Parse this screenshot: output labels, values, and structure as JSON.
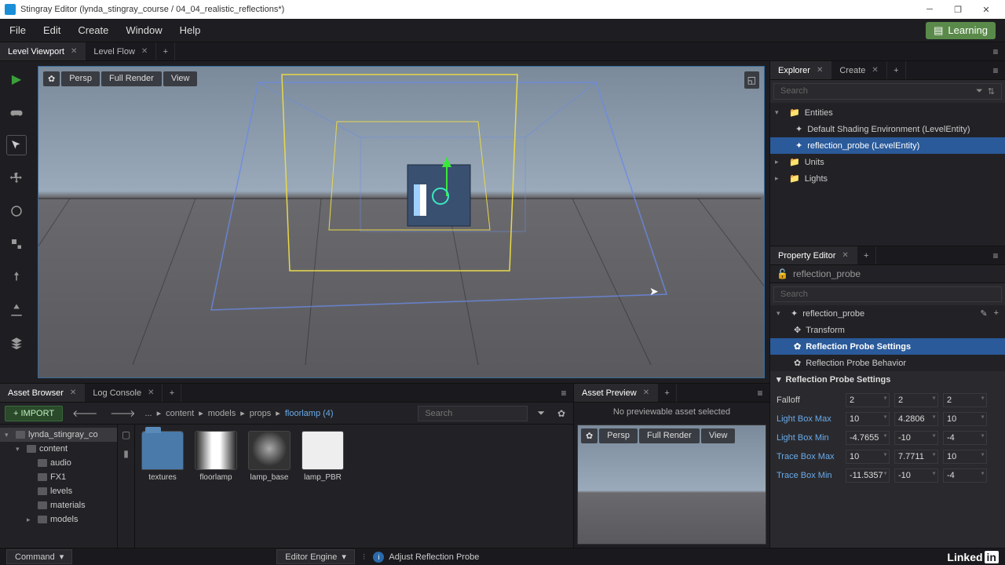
{
  "window": {
    "title": "Stingray Editor (lynda_stingray_course / 04_04_realistic_reflections*)"
  },
  "menubar": {
    "items": [
      "File",
      "Edit",
      "Create",
      "Window",
      "Help"
    ],
    "learning": "Learning"
  },
  "main_tabs": {
    "viewport": "Level Viewport",
    "flow": "Level Flow"
  },
  "viewport": {
    "persp": "Persp",
    "render": "Full Render",
    "view": "View"
  },
  "bottom_tabs": {
    "asset_browser": "Asset Browser",
    "log_console": "Log Console",
    "asset_preview": "Asset Preview"
  },
  "asset_browser": {
    "import": "+ IMPORT",
    "breadcrumb": [
      "...",
      "content",
      "models",
      "props",
      "floorlamp (4)"
    ],
    "search_placeholder": "Search",
    "tree": {
      "root": "lynda_stingray_co",
      "items": [
        "content",
        "audio",
        "FX1",
        "levels",
        "materials",
        "models"
      ]
    },
    "thumbs": [
      {
        "label": "textures",
        "type": "folder"
      },
      {
        "label": "floorlamp",
        "type": "tex"
      },
      {
        "label": "lamp_base",
        "type": "tex"
      },
      {
        "label": "lamp_PBR",
        "type": "tex"
      }
    ]
  },
  "asset_preview": {
    "msg": "No previewable asset selected",
    "persp": "Persp",
    "render": "Full Render",
    "view": "View"
  },
  "right_tabs": {
    "explorer": "Explorer",
    "create": "Create",
    "property_editor": "Property Editor"
  },
  "explorer": {
    "search_placeholder": "Search",
    "entities_label": "Entities",
    "items": [
      "Default Shading Environment (LevelEntity)",
      "reflection_probe (LevelEntity)"
    ],
    "units": "Units",
    "lights": "Lights"
  },
  "property_editor": {
    "name": "reflection_probe",
    "search_placeholder": "Search",
    "root": "reflection_probe",
    "transform": "Transform",
    "settings": "Reflection Probe Settings",
    "behavior": "Reflection Probe Behavior",
    "section": "Reflection Probe Settings",
    "rows": [
      {
        "label": "Falloff",
        "plain": true,
        "v": [
          "2",
          "2",
          "2"
        ]
      },
      {
        "label": "Light Box Max",
        "v": [
          "10",
          "4.2806",
          "10"
        ]
      },
      {
        "label": "Light Box Min",
        "v": [
          "-4.7655",
          "-10",
          "-4"
        ]
      },
      {
        "label": "Trace Box Max",
        "v": [
          "10",
          "7.7711",
          "10"
        ]
      },
      {
        "label": "Trace Box Min",
        "v": [
          "-11.5357",
          "-10",
          "-4"
        ]
      }
    ]
  },
  "statusbar": {
    "command": "Command",
    "engine": "Editor Engine",
    "info": "Adjust Reflection Probe",
    "branding": "Linked"
  }
}
